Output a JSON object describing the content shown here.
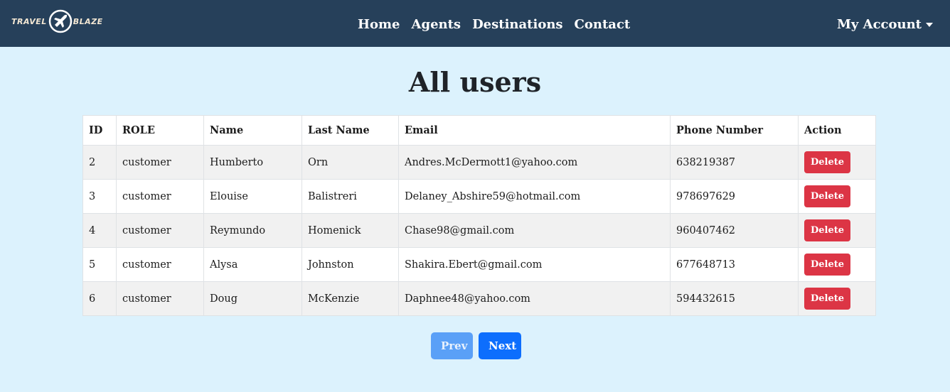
{
  "brand": {
    "left": "TRAVEL",
    "right": "BLAZE"
  },
  "nav": {
    "links": [
      "Home",
      "Agents",
      "Destinations",
      "Contact"
    ],
    "account": "My Account"
  },
  "page": {
    "title": "All users"
  },
  "table": {
    "headers": [
      "ID",
      "ROLE",
      "Name",
      "Last Name",
      "Email",
      "Phone Number",
      "Action"
    ],
    "rows": [
      {
        "id": "2",
        "role": "customer",
        "name": "Humberto",
        "last": "Orn",
        "email": "Andres.McDermott1@yahoo.com",
        "phone": "638219387",
        "action": "Delete"
      },
      {
        "id": "3",
        "role": "customer",
        "name": "Elouise",
        "last": "Balistreri",
        "email": "Delaney_Abshire59@hotmail.com",
        "phone": "978697629",
        "action": "Delete"
      },
      {
        "id": "4",
        "role": "customer",
        "name": "Reymundo",
        "last": "Homenick",
        "email": "Chase98@gmail.com",
        "phone": "960407462",
        "action": "Delete"
      },
      {
        "id": "5",
        "role": "customer",
        "name": "Alysa",
        "last": "Johnston",
        "email": "Shakira.Ebert@gmail.com",
        "phone": "677648713",
        "action": "Delete"
      },
      {
        "id": "6",
        "role": "customer",
        "name": "Doug",
        "last": "McKenzie",
        "email": "Daphnee48@yahoo.com",
        "phone": "594432615",
        "action": "Delete"
      }
    ]
  },
  "pagination": {
    "prev": "Prev",
    "next": "Next"
  },
  "colors": {
    "navbar": "#26405a",
    "background": "#dcf2fd",
    "danger": "#dc3545",
    "primary": "#0d6efd"
  }
}
